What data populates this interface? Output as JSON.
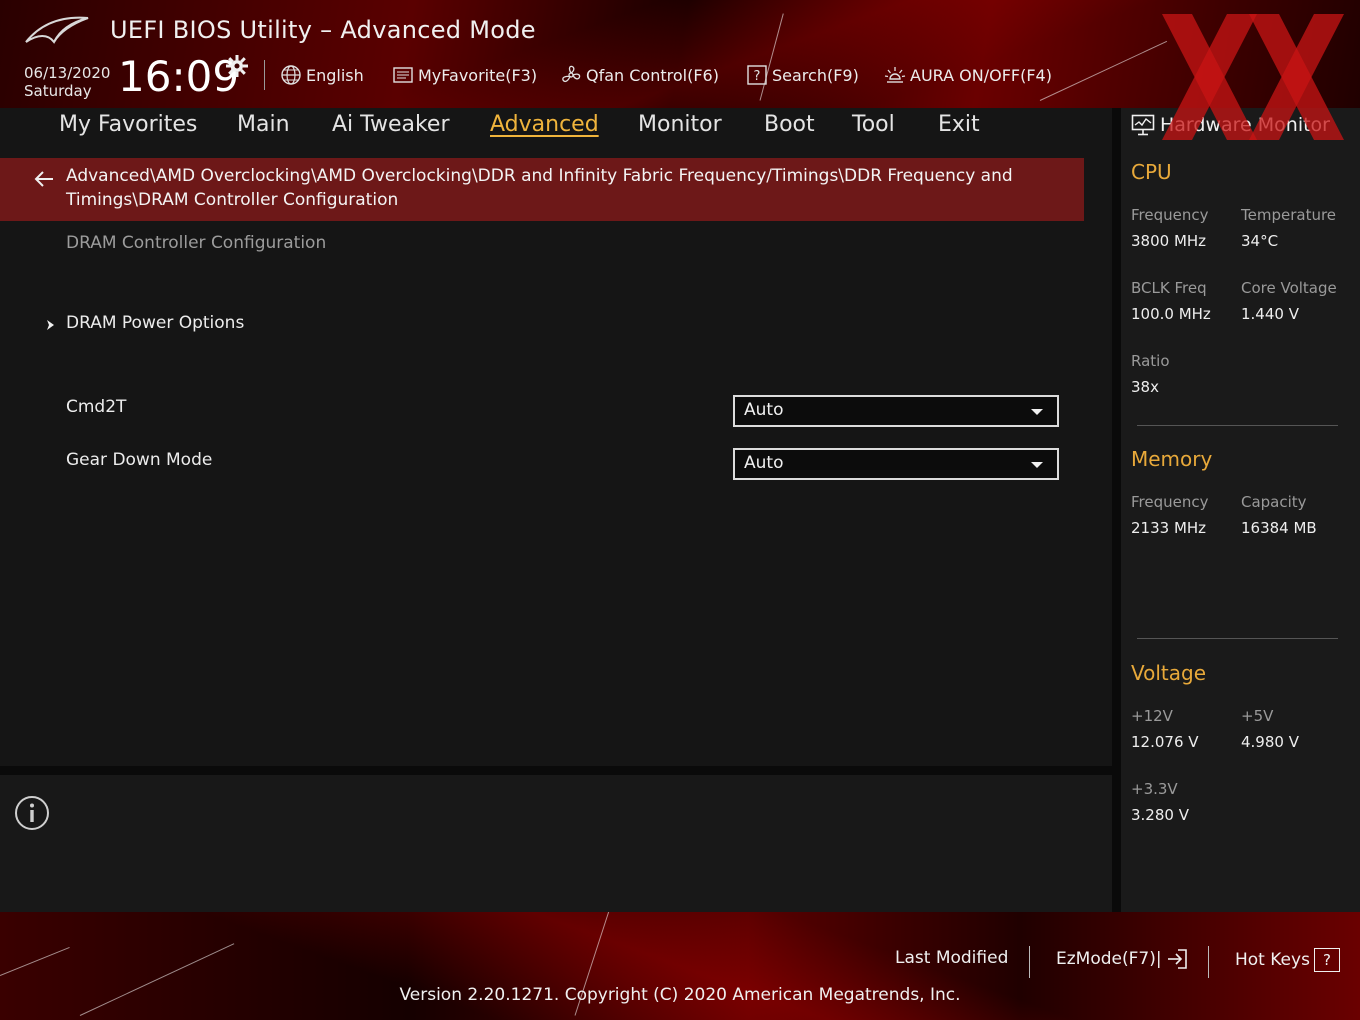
{
  "header": {
    "title": "UEFI BIOS Utility – Advanced Mode",
    "date": "06/13/2020",
    "day": "Saturday",
    "time": "16:09",
    "language": "English",
    "myfavorite": "MyFavorite(F3)",
    "qfan": "Qfan Control(F6)",
    "search": "Search(F9)",
    "aura": "AURA ON/OFF(F4)"
  },
  "tabs": [
    "My Favorites",
    "Main",
    "Ai Tweaker",
    "Advanced",
    "Monitor",
    "Boot",
    "Tool",
    "Exit"
  ],
  "active_tab": "Advanced",
  "breadcrumb": "Advanced\\AMD Overclocking\\AMD Overclocking\\DDR and Infinity Fabric Frequency/Timings\\DDR Frequency and Timings\\DRAM Controller Configuration",
  "section_title": "DRAM Controller Configuration",
  "submenu": "DRAM Power Options",
  "settings": [
    {
      "label": "Cmd2T",
      "value": "Auto"
    },
    {
      "label": "Gear Down Mode",
      "value": "Auto"
    }
  ],
  "hardware_monitor": {
    "title": "Hardware Monitor",
    "cpu": {
      "heading": "CPU",
      "freq_label": "Frequency",
      "freq": "3800 MHz",
      "temp_label": "Temperature",
      "temp": "34°C",
      "bclk_label": "BCLK Freq",
      "bclk": "100.0 MHz",
      "vcore_label": "Core Voltage",
      "vcore": "1.440 V",
      "ratio_label": "Ratio",
      "ratio": "38x"
    },
    "memory": {
      "heading": "Memory",
      "freq_label": "Frequency",
      "freq": "2133 MHz",
      "cap_label": "Capacity",
      "cap": "16384 MB"
    },
    "voltage": {
      "heading": "Voltage",
      "v12_label": "+12V",
      "v12": "12.076 V",
      "v5_label": "+5V",
      "v5": "4.980 V",
      "v33_label": "+3.3V",
      "v33": "3.280 V"
    }
  },
  "footer": {
    "last_modified": "Last Modified",
    "ezmode": "EzMode(F7)|",
    "hotkeys": "Hot Keys",
    "hotkeys_icon": "?",
    "version": "Version 2.20.1271. Copyright (C) 2020 American Megatrends, Inc."
  },
  "colors": {
    "accent": "#f0b43c",
    "breadcrumb_bg": "#6d1818",
    "panel_bg": "#151515"
  }
}
